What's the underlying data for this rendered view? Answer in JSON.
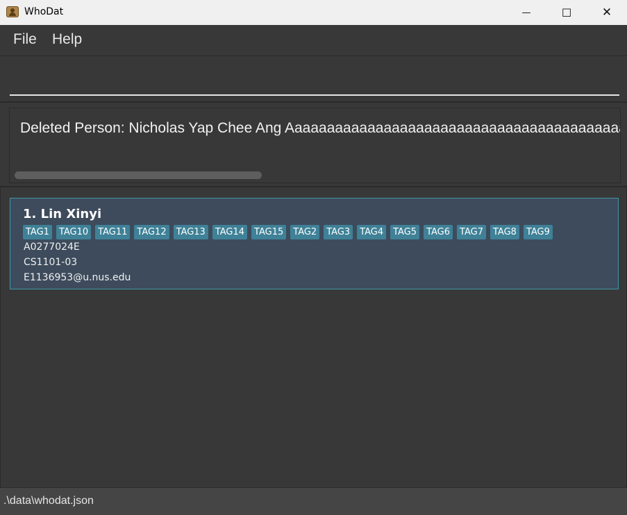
{
  "window": {
    "title": "WhoDat",
    "minimize_glyph": "—",
    "maximize_glyph": "☐",
    "close_glyph": "✕"
  },
  "menu": {
    "items": [
      {
        "label": "File"
      },
      {
        "label": "Help"
      }
    ]
  },
  "command": {
    "value": "",
    "placeholder": ""
  },
  "result": {
    "text": "Deleted Person: Nicholas Yap Chee Ang Aaaaaaaaaaaaaaaaaaaaaaaaaaaaaaaaaaaaaaaaaaaaaaa"
  },
  "persons": [
    {
      "index_name": "1. Lin Xinyi",
      "tags": [
        "TAG1",
        "TAG10",
        "TAG11",
        "TAG12",
        "TAG13",
        "TAG14",
        "TAG15",
        "TAG2",
        "TAG3",
        "TAG4",
        "TAG5",
        "TAG6",
        "TAG7",
        "TAG8",
        "TAG9"
      ],
      "student_id": "A0277024E",
      "group": "CS1101-03",
      "email": "E1136953@u.nus.edu"
    }
  ],
  "status": {
    "file_path": ".\\data\\whodat.json"
  },
  "colors": {
    "card_bg": "#3d4b5c",
    "card_border": "#3e97a8",
    "tag_bg": "#3f8197",
    "app_bg": "#383838"
  }
}
